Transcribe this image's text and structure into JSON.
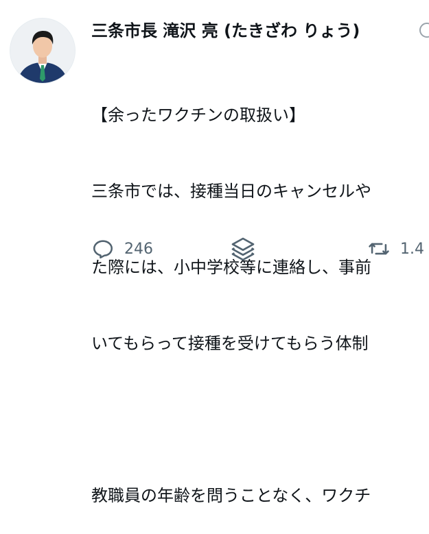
{
  "tweet": {
    "author_name": "三条市長 滝沢 亮 (たきざわ りょう)",
    "lines": [
      "【余ったワクチンの取扱い】",
      "三条市では、接種当日のキャンセルや",
      "た際には、小中学校等に連絡し、事前",
      "いてもらって接種を受けてもらう体制",
      "",
      "教職員の年齢を問うことなく、ワクチ"
    ]
  },
  "actions": {
    "reply_count": "246",
    "retweet_count": "1.4"
  },
  "icons": {
    "reply": "reply-icon",
    "stack": "layers-icon",
    "retweet": "retweet-icon",
    "verified": "verified-icon"
  },
  "colors": {
    "text": "#0f1419",
    "muted": "#536471",
    "avatar_bg": "#ecf0f3"
  }
}
